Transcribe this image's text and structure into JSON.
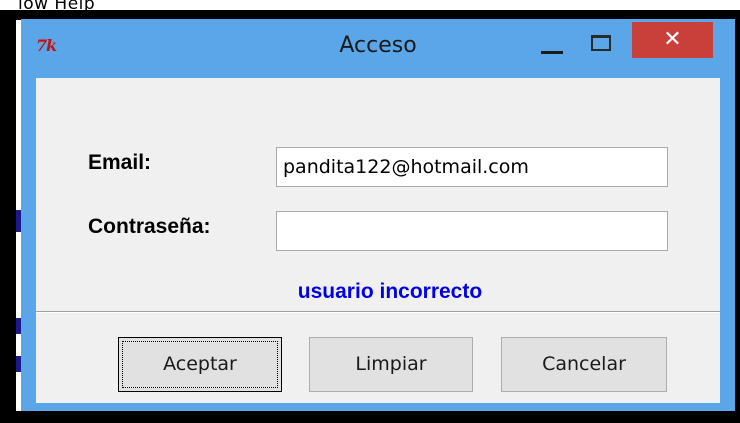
{
  "background": {
    "menu_text": "low   Help"
  },
  "window": {
    "title": "Acceso",
    "icon": "tk-feather-icon",
    "close_label": "✕"
  },
  "form": {
    "email_label": "Email:",
    "email_value": "pandita122@hotmail.com",
    "password_label": "Contraseña:",
    "password_value": "",
    "message": "usuario incorrecto"
  },
  "buttons": {
    "accept": "Aceptar",
    "clear": "Limpiar",
    "cancel": "Cancelar"
  },
  "colors": {
    "window_border": "#5aa6e8",
    "close_button": "#c9403a",
    "message_text": "#0000e6",
    "client_bg": "#f0f0f0"
  }
}
